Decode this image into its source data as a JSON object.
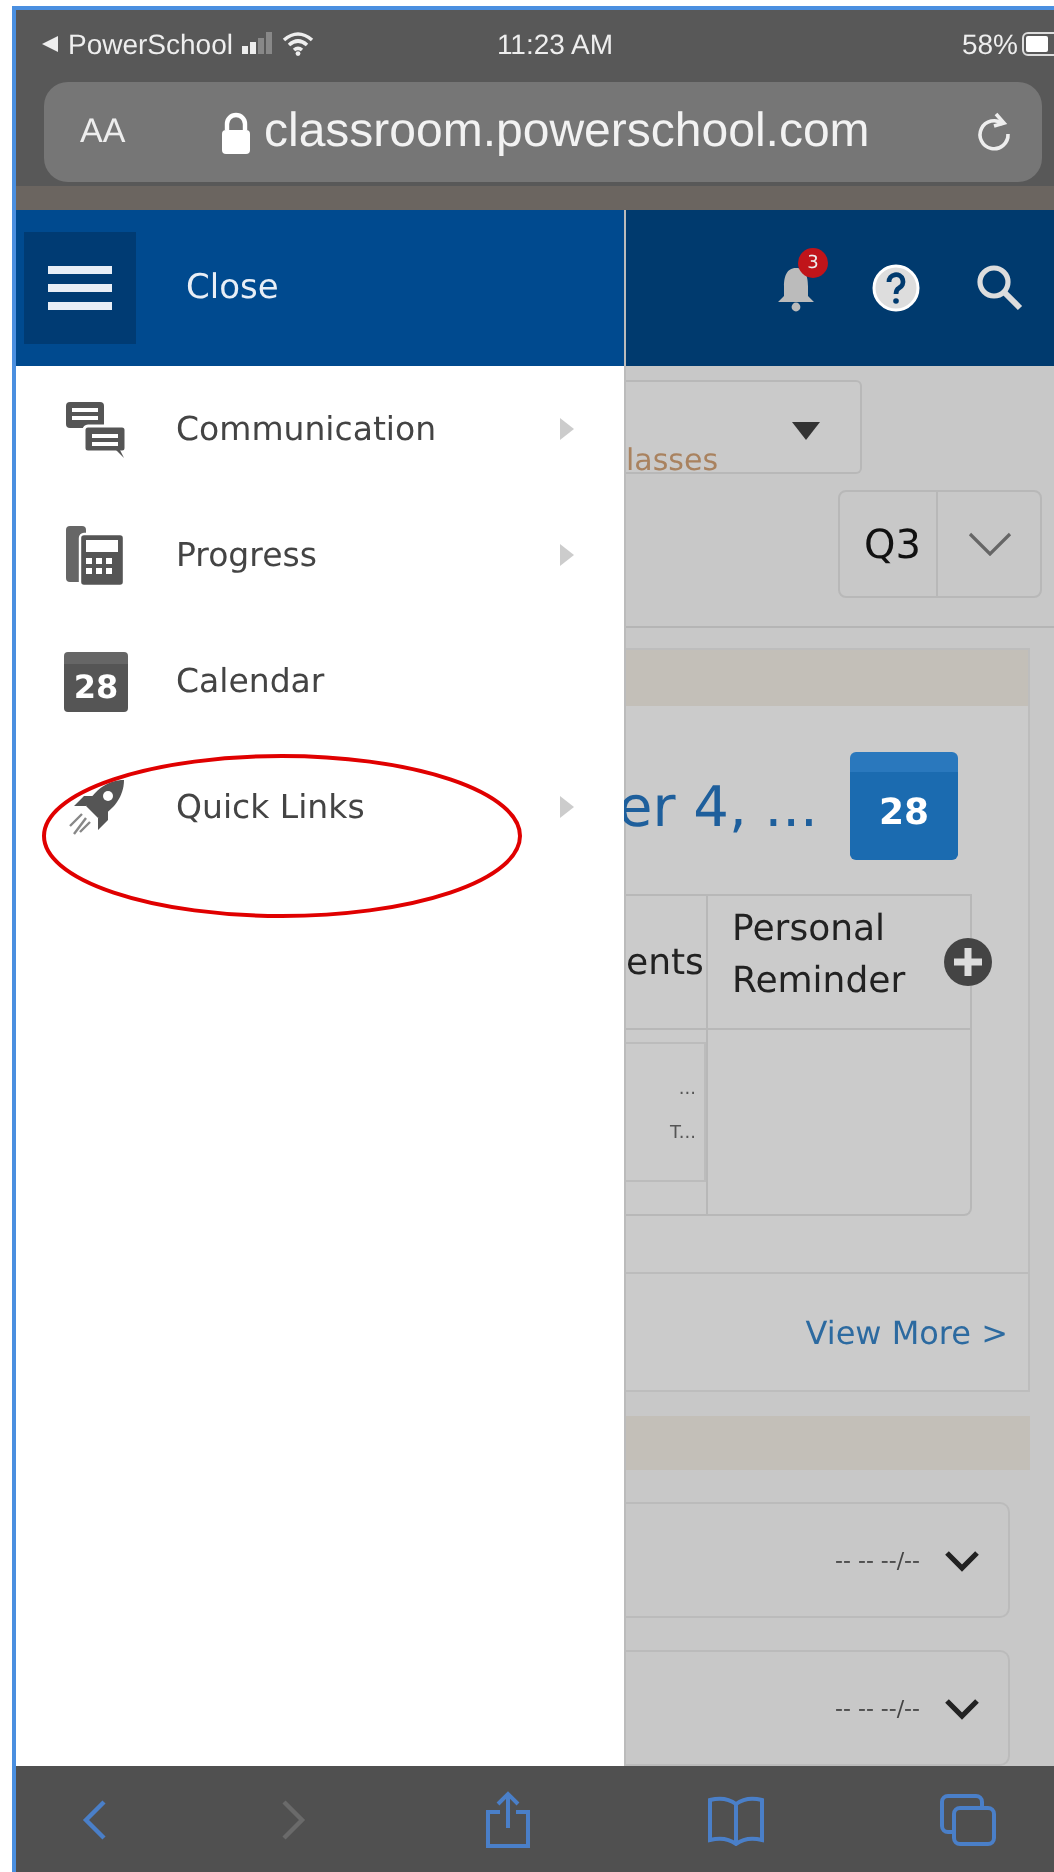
{
  "status_bar": {
    "back_app": "PowerSchool",
    "time": "11:23 AM",
    "battery": "58%"
  },
  "address_bar": {
    "text_size": "AA",
    "url": "classroom.powerschool.com"
  },
  "header": {
    "menu_label": "Close",
    "notification_count": "3"
  },
  "menu": [
    {
      "label": "Communication",
      "kind": "chat",
      "has_submenu": true,
      "highlighted": false
    },
    {
      "label": "Progress",
      "kind": "calculator",
      "has_submenu": true,
      "highlighted": false
    },
    {
      "label": "Calendar",
      "kind": "calendar",
      "icon_text": "28",
      "has_submenu": false,
      "highlighted": false
    },
    {
      "label": "Quick Links",
      "kind": "rocket",
      "has_submenu": true,
      "highlighted": true
    }
  ],
  "page": {
    "classes_link": "lasses",
    "term": "Q3",
    "date_title": "er 4, ...",
    "calendar_badge": "28",
    "columns": [
      "ents",
      "Personal Reminder"
    ],
    "cells": [
      "...",
      "T..."
    ],
    "view_more": "View More >",
    "rows": [
      {
        "value": "-- -- --/--"
      },
      {
        "value": "-- -- --/--"
      }
    ]
  }
}
